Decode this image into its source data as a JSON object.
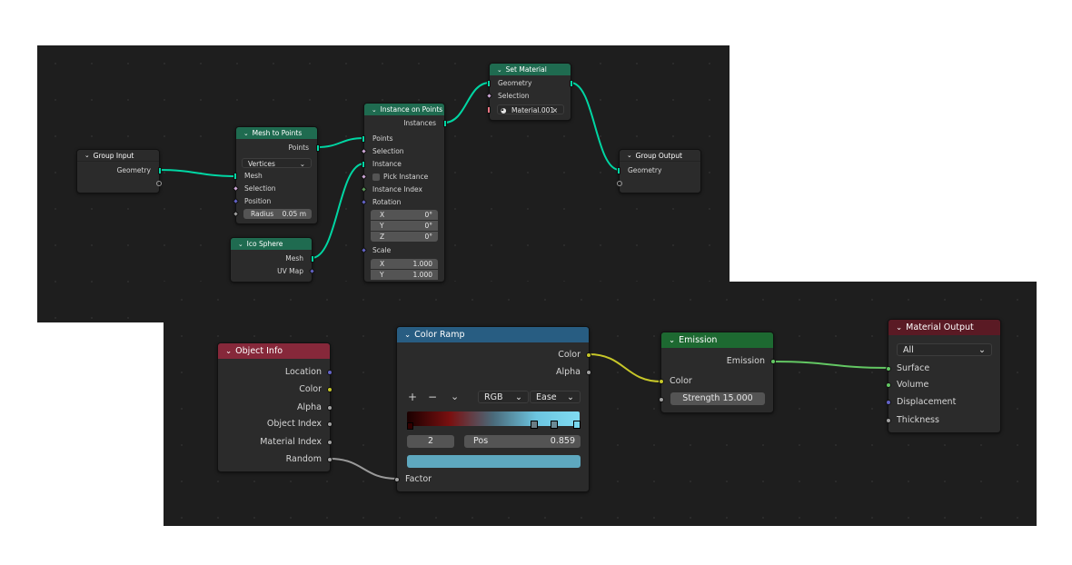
{
  "top_nodes": {
    "group_input": {
      "title": "Group Input",
      "outputs": [
        "Geometry"
      ]
    },
    "mesh_to_points": {
      "title": "Mesh to Points",
      "outputs": [
        "Points"
      ],
      "mode": "Vertices",
      "inputs": [
        "Mesh",
        "Selection",
        "Position"
      ],
      "radius_label": "Radius",
      "radius_value": "0.05 m"
    },
    "ico_sphere": {
      "title": "Ico Sphere",
      "outputs": [
        "Mesh",
        "UV Map"
      ]
    },
    "instance_on_points": {
      "title": "Instance on Points",
      "outputs": [
        "Instances"
      ],
      "inputs": [
        "Points",
        "Selection",
        "Instance"
      ],
      "pick_instance": "Pick Instance",
      "instance_index": "Instance Index",
      "rotation": "Rotation",
      "rotation_fields": [
        {
          "label": "X",
          "value": "0°"
        },
        {
          "label": "Y",
          "value": "0°"
        },
        {
          "label": "Z",
          "value": "0°"
        }
      ],
      "scale": "Scale",
      "scale_fields": [
        {
          "label": "X",
          "value": "1.000"
        },
        {
          "label": "Y",
          "value": "1.000"
        }
      ]
    },
    "set_material": {
      "title": "Set Material",
      "inputs": [
        "Geometry",
        "Selection"
      ],
      "material": "Material.001"
    },
    "group_output": {
      "title": "Group Output",
      "inputs": [
        "Geometry"
      ]
    }
  },
  "bottom_nodes": {
    "object_info": {
      "title": "Object Info",
      "outputs": [
        "Location",
        "Color",
        "Alpha",
        "Object Index",
        "Material Index",
        "Random"
      ]
    },
    "color_ramp": {
      "title": "Color Ramp",
      "outputs": [
        "Color",
        "Alpha"
      ],
      "color_mode": "RGB",
      "interpolation": "Ease",
      "stop_index": "2",
      "pos_label": "Pos",
      "pos_value": "0.859",
      "input": "Factor",
      "gradient": [
        "#1a0000",
        "#7a1010",
        "#4a6a7a",
        "#6cc5e0",
        "#80dcf2"
      ],
      "swatch_color": "#5ea8bf"
    },
    "emission": {
      "title": "Emission",
      "output": "Emission",
      "inputs": [
        "Color"
      ],
      "strength_label": "Strength",
      "strength_value": "15.000"
    },
    "material_output": {
      "title": "Material Output",
      "target": "All",
      "inputs": [
        "Surface",
        "Volume",
        "Displacement",
        "Thickness"
      ]
    }
  },
  "colors": {
    "geometry_socket": "#00d6a3",
    "color_socket": "#c7c729",
    "shader_socket": "#63c763",
    "float_socket": "#a1a1a1",
    "vector_socket": "#6363c7"
  }
}
